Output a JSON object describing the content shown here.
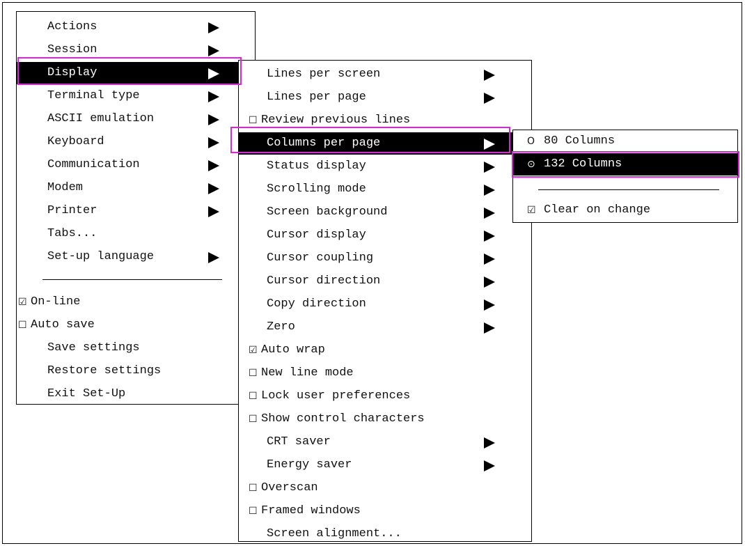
{
  "main_menu": {
    "items": [
      {
        "label": "Actions",
        "arrow": true
      },
      {
        "label": "Session",
        "arrow": true
      },
      {
        "label": "Display",
        "arrow": true,
        "selected": true
      },
      {
        "label": "Terminal type",
        "arrow": true
      },
      {
        "label": "ASCII emulation",
        "arrow": true
      },
      {
        "label": "Keyboard",
        "arrow": true
      },
      {
        "label": "Communication",
        "arrow": true
      },
      {
        "label": "Modem",
        "arrow": true
      },
      {
        "label": "Printer",
        "arrow": true
      },
      {
        "label": "Tabs...",
        "arrow": false
      },
      {
        "label": "Set-up language",
        "arrow": true
      }
    ],
    "options": [
      {
        "label": "On-line",
        "checked": true
      },
      {
        "label": "Auto save",
        "checked": false
      }
    ],
    "commands": [
      "Save settings",
      "Restore settings",
      "Exit Set-Up"
    ]
  },
  "display_menu": {
    "items": [
      {
        "label": "Lines per screen",
        "arrow": true
      },
      {
        "label": "Lines per page",
        "arrow": true
      },
      {
        "label": "Review previous lines",
        "checkbox": false
      },
      {
        "label": "Columns per page",
        "arrow": true,
        "selected": true
      },
      {
        "label": "Status display",
        "arrow": true
      },
      {
        "label": "Scrolling mode",
        "arrow": true
      },
      {
        "label": "Screen background",
        "arrow": true
      },
      {
        "label": "Cursor display",
        "arrow": true
      },
      {
        "label": "Cursor coupling",
        "arrow": true
      },
      {
        "label": "Cursor direction",
        "arrow": true
      },
      {
        "label": "Copy direction",
        "arrow": true
      },
      {
        "label": "Zero",
        "arrow": true
      },
      {
        "label": "Auto wrap",
        "checkbox": true
      },
      {
        "label": "New line mode",
        "checkbox": false
      },
      {
        "label": "Lock user preferences",
        "checkbox": false
      },
      {
        "label": "Show control characters",
        "checkbox": false
      },
      {
        "label": "CRT saver",
        "arrow": true
      },
      {
        "label": "Energy saver",
        "arrow": true
      },
      {
        "label": "Overscan",
        "checkbox": false
      },
      {
        "label": "Framed windows",
        "checkbox": false
      },
      {
        "label": "Screen alignment...",
        "arrow": false
      }
    ]
  },
  "columns_menu": {
    "options": [
      {
        "label": "80 Columns",
        "mark": "O",
        "selected": false
      },
      {
        "label": "132 Columns",
        "mark": "⊙",
        "selected": true
      }
    ],
    "clear_on_change": {
      "label": "Clear on change",
      "checked": true
    }
  },
  "glyphs": {
    "checked": "☑",
    "unchecked": "☐"
  },
  "colors": {
    "highlight": "#e022e0",
    "selected_bg": "#000000"
  }
}
